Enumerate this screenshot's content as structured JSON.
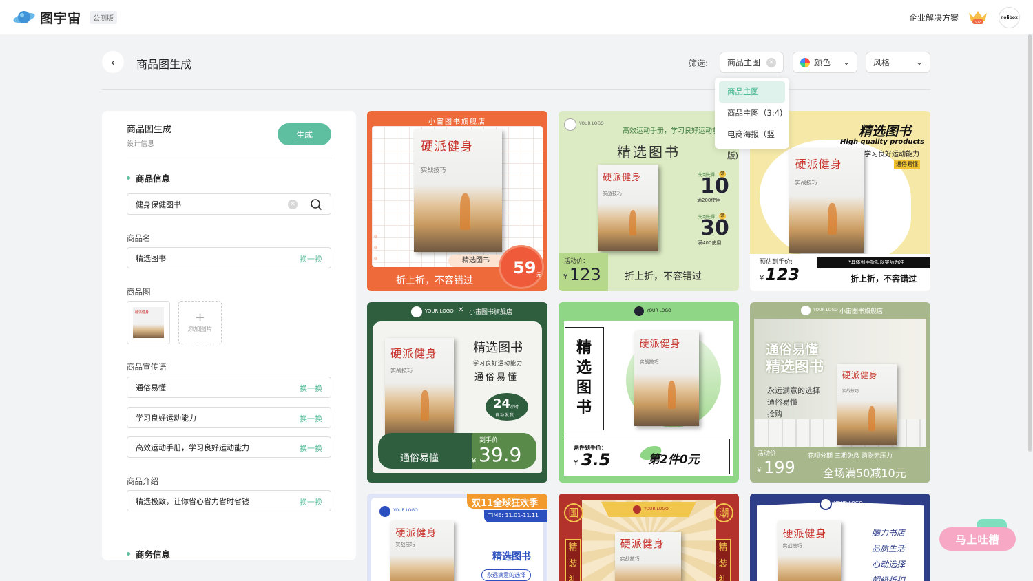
{
  "header": {
    "app_name": "图宇宙",
    "badge": "公测版",
    "enterprise_link": "企业解决方案",
    "vip_label": "VIP",
    "avatar_text": "nolibox"
  },
  "toolbar": {
    "back_icon": "chevron-left-icon",
    "page_title": "商品图生成",
    "filter_label": "筛选:",
    "filters": [
      {
        "value": "商品主图",
        "icon": "close-icon"
      },
      {
        "value": "颜色",
        "icon": "color-wheel-icon"
      },
      {
        "value": "风格",
        "icon": "chevron-down-icon"
      }
    ],
    "dropdown_options": [
      "商品主图",
      "商品主图（3:4)",
      "电商海报（竖版)"
    ]
  },
  "form": {
    "title": "商品图生成",
    "subtitle": "设计信息",
    "generate_label": "生成",
    "section_product": "商品信息",
    "search_value": "健身保健图书",
    "name_label": "商品名",
    "name_value": "精选图书",
    "swap_label": "换一换",
    "image_label": "商品图",
    "add_image_label": "添加图片",
    "slogan_label": "商品宣传语",
    "slogans": [
      "通俗易懂",
      "学习良好运动能力",
      "高效运动手册，学习良好运动能力"
    ],
    "intro_label": "商品介绍",
    "intro_value": "精选极致，让你省心省力省时省钱",
    "section_business": "商务信息"
  },
  "book": {
    "title": "硬派健身",
    "subtitle": "实战技巧"
  },
  "cards": {
    "c1": {
      "store": "小宙图书旗舰店",
      "name": "精选图书",
      "price": "59",
      "unit": "元",
      "slogan": "折上折，不容错过",
      "bg": "#ee6a3a"
    },
    "c2": {
      "logo": "YOUR LOGO",
      "tagline": "高效运动手册，学习良好运动能力",
      "name": "精选图书",
      "coupon1_label": "先到先得",
      "coupon1": "10",
      "coupon1_note": "满200使用",
      "coupon2_label": "先到先得",
      "coupon2": "30",
      "coupon2_note": "满400使用",
      "price_label": "活动价：",
      "currency": "¥",
      "price": "123",
      "slogan": "折上折，不容错过",
      "bg": "#dcebc3"
    },
    "c3": {
      "name": "精选图书",
      "en": "High quality products",
      "tagline": "学习良好运动能力",
      "tag": "通俗易懂",
      "price_label": "预估到手价:",
      "note": "*具体到手折扣以实际为准",
      "currency": "¥",
      "price": "123",
      "slogan": "折上折，不容错过",
      "bg": "#f6e9a8"
    },
    "c4": {
      "logo": "YOUR LOGO",
      "store": "小宙图书旗舰店",
      "name": "精选图书",
      "tagline": "学习良好运动能力",
      "tag": "通俗易懂",
      "hours": "24",
      "hours_unit": "小时",
      "ship": "自动发货",
      "price_label": "到手价",
      "currency": "¥",
      "price": "39.9",
      "slogan": "通俗易懂",
      "bg": "#2f5e3f"
    },
    "c5": {
      "logo": "YOUR LOGO",
      "vertical": [
        "精",
        "选",
        "图",
        "书"
      ],
      "price_label": "两件到手价：",
      "currency": "¥",
      "price": "3.5",
      "promo": "第2件0元",
      "bg": "#8fd686"
    },
    "c6": {
      "logo": "YOUR LOGO",
      "store": "小宙图书旗舰店",
      "headline1": "通俗易懂",
      "headline2": "精选图书",
      "lines": [
        "永远满意的选择",
        "通俗易懂",
        "抢购"
      ],
      "price_label": "活动价",
      "currency": "¥",
      "price": "199",
      "installment": "花呗分期 三期免息 购物无压力",
      "promo": "全场满50减10元",
      "bg": "#a9b88c"
    },
    "c7": {
      "logo": "YOUR LOGO",
      "event": "双11全球狂欢季",
      "time": "TIME: 11.01-11.11",
      "name": "精选图书",
      "tagline": "永远满意的选择",
      "bg": "#dfe4f6"
    },
    "c8": {
      "logo": "YOUR LOGO",
      "left": "国",
      "right": "潮",
      "side_left": [
        "精",
        "装",
        "礼"
      ],
      "side_right": [
        "精",
        "装",
        "礼"
      ],
      "bg": "#b4322c"
    },
    "c9": {
      "logo": "YOUR LOGO",
      "lines": [
        "脑力书店",
        "品质生活",
        "心动选择",
        "超级折扣"
      ],
      "bg": "#2d3d88"
    }
  },
  "feedback": {
    "label": "马上吐槽"
  }
}
